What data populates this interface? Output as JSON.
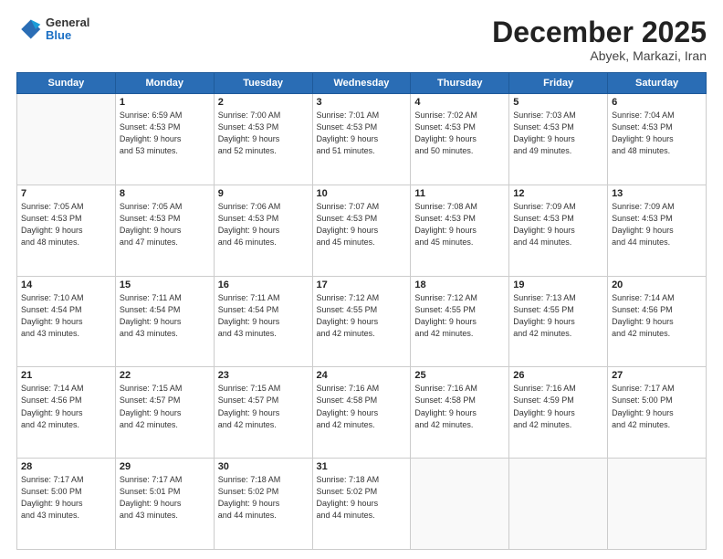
{
  "logo": {
    "general": "General",
    "blue": "Blue"
  },
  "header": {
    "month": "December 2025",
    "location": "Abyek, Markazi, Iran"
  },
  "weekdays": [
    "Sunday",
    "Monday",
    "Tuesday",
    "Wednesday",
    "Thursday",
    "Friday",
    "Saturday"
  ],
  "weeks": [
    [
      {
        "day": "",
        "info": ""
      },
      {
        "day": "1",
        "info": "Sunrise: 6:59 AM\nSunset: 4:53 PM\nDaylight: 9 hours\nand 53 minutes."
      },
      {
        "day": "2",
        "info": "Sunrise: 7:00 AM\nSunset: 4:53 PM\nDaylight: 9 hours\nand 52 minutes."
      },
      {
        "day": "3",
        "info": "Sunrise: 7:01 AM\nSunset: 4:53 PM\nDaylight: 9 hours\nand 51 minutes."
      },
      {
        "day": "4",
        "info": "Sunrise: 7:02 AM\nSunset: 4:53 PM\nDaylight: 9 hours\nand 50 minutes."
      },
      {
        "day": "5",
        "info": "Sunrise: 7:03 AM\nSunset: 4:53 PM\nDaylight: 9 hours\nand 49 minutes."
      },
      {
        "day": "6",
        "info": "Sunrise: 7:04 AM\nSunset: 4:53 PM\nDaylight: 9 hours\nand 48 minutes."
      }
    ],
    [
      {
        "day": "7",
        "info": "Sunrise: 7:05 AM\nSunset: 4:53 PM\nDaylight: 9 hours\nand 48 minutes."
      },
      {
        "day": "8",
        "info": "Sunrise: 7:05 AM\nSunset: 4:53 PM\nDaylight: 9 hours\nand 47 minutes."
      },
      {
        "day": "9",
        "info": "Sunrise: 7:06 AM\nSunset: 4:53 PM\nDaylight: 9 hours\nand 46 minutes."
      },
      {
        "day": "10",
        "info": "Sunrise: 7:07 AM\nSunset: 4:53 PM\nDaylight: 9 hours\nand 45 minutes."
      },
      {
        "day": "11",
        "info": "Sunrise: 7:08 AM\nSunset: 4:53 PM\nDaylight: 9 hours\nand 45 minutes."
      },
      {
        "day": "12",
        "info": "Sunrise: 7:09 AM\nSunset: 4:53 PM\nDaylight: 9 hours\nand 44 minutes."
      },
      {
        "day": "13",
        "info": "Sunrise: 7:09 AM\nSunset: 4:53 PM\nDaylight: 9 hours\nand 44 minutes."
      }
    ],
    [
      {
        "day": "14",
        "info": "Sunrise: 7:10 AM\nSunset: 4:54 PM\nDaylight: 9 hours\nand 43 minutes."
      },
      {
        "day": "15",
        "info": "Sunrise: 7:11 AM\nSunset: 4:54 PM\nDaylight: 9 hours\nand 43 minutes."
      },
      {
        "day": "16",
        "info": "Sunrise: 7:11 AM\nSunset: 4:54 PM\nDaylight: 9 hours\nand 43 minutes."
      },
      {
        "day": "17",
        "info": "Sunrise: 7:12 AM\nSunset: 4:55 PM\nDaylight: 9 hours\nand 42 minutes."
      },
      {
        "day": "18",
        "info": "Sunrise: 7:12 AM\nSunset: 4:55 PM\nDaylight: 9 hours\nand 42 minutes."
      },
      {
        "day": "19",
        "info": "Sunrise: 7:13 AM\nSunset: 4:55 PM\nDaylight: 9 hours\nand 42 minutes."
      },
      {
        "day": "20",
        "info": "Sunrise: 7:14 AM\nSunset: 4:56 PM\nDaylight: 9 hours\nand 42 minutes."
      }
    ],
    [
      {
        "day": "21",
        "info": "Sunrise: 7:14 AM\nSunset: 4:56 PM\nDaylight: 9 hours\nand 42 minutes."
      },
      {
        "day": "22",
        "info": "Sunrise: 7:15 AM\nSunset: 4:57 PM\nDaylight: 9 hours\nand 42 minutes."
      },
      {
        "day": "23",
        "info": "Sunrise: 7:15 AM\nSunset: 4:57 PM\nDaylight: 9 hours\nand 42 minutes."
      },
      {
        "day": "24",
        "info": "Sunrise: 7:16 AM\nSunset: 4:58 PM\nDaylight: 9 hours\nand 42 minutes."
      },
      {
        "day": "25",
        "info": "Sunrise: 7:16 AM\nSunset: 4:58 PM\nDaylight: 9 hours\nand 42 minutes."
      },
      {
        "day": "26",
        "info": "Sunrise: 7:16 AM\nSunset: 4:59 PM\nDaylight: 9 hours\nand 42 minutes."
      },
      {
        "day": "27",
        "info": "Sunrise: 7:17 AM\nSunset: 5:00 PM\nDaylight: 9 hours\nand 42 minutes."
      }
    ],
    [
      {
        "day": "28",
        "info": "Sunrise: 7:17 AM\nSunset: 5:00 PM\nDaylight: 9 hours\nand 43 minutes."
      },
      {
        "day": "29",
        "info": "Sunrise: 7:17 AM\nSunset: 5:01 PM\nDaylight: 9 hours\nand 43 minutes."
      },
      {
        "day": "30",
        "info": "Sunrise: 7:18 AM\nSunset: 5:02 PM\nDaylight: 9 hours\nand 44 minutes."
      },
      {
        "day": "31",
        "info": "Sunrise: 7:18 AM\nSunset: 5:02 PM\nDaylight: 9 hours\nand 44 minutes."
      },
      {
        "day": "",
        "info": ""
      },
      {
        "day": "",
        "info": ""
      },
      {
        "day": "",
        "info": ""
      }
    ]
  ]
}
